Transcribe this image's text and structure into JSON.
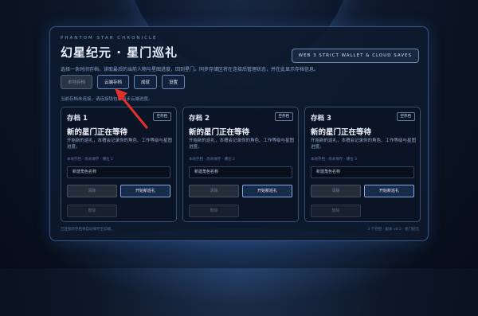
{
  "header": {
    "eyebrow": "PHANTOM STAR CHRONICLE",
    "title": "幻星纪元 · 星门巡礼",
    "subtitle": "选择一条时间存档，读取最后的当前人物与星图进度，回到星门。同步存储区将在连接后管理状态，并在此显示存档信息。",
    "network_label": "WEB 3 STRICT WALLET & CLOUD SAVES"
  },
  "tabs": [
    {
      "label": "本地存档",
      "active": true
    },
    {
      "label": "云端存档",
      "active": false
    },
    {
      "label": "成就",
      "active": false
    },
    {
      "label": "设置",
      "active": false
    }
  ],
  "note": "当前存档未连接，请连接钱包后同步云端进度。",
  "slots": [
    {
      "name": "存档 1",
      "badge": "空存档",
      "status": "新的星门正在等待",
      "description": "开始新的巡礼，本槽会记录你的角色、工作等级与星图进度。",
      "hint": "本地存档 · 尚未保存 · 槽位 1",
      "input_placeholder": "新建角色名称",
      "clear_label": "清除",
      "start_label": "开始新巡礼",
      "delete_label": "删除"
    },
    {
      "name": "存档 2",
      "badge": "空存档",
      "status": "新的星门正在等待",
      "description": "开始新的巡礼，本槽会记录你的角色、工作等级与星图进度。",
      "hint": "本地存档 · 尚未保存 · 槽位 2",
      "input_placeholder": "新建角色名称",
      "clear_label": "清除",
      "start_label": "开始新巡礼",
      "delete_label": "删除"
    },
    {
      "name": "存档 3",
      "badge": "空存档",
      "status": "新的星门正在等待",
      "description": "开始新的巡礼，本槽会记录你的角色、工作等级与星图进度。",
      "hint": "本地存档 · 尚未保存 · 槽位 3",
      "input_placeholder": "新建角色名称",
      "clear_label": "清除",
      "start_label": "开始新巡礼",
      "delete_label": "删除"
    }
  ],
  "footer": {
    "left": "已连接的存档将自动保存至云端。",
    "right": "3 个存档 · 版本 v0.2 · 星门纪元"
  },
  "colors": {
    "accent": "#e0312b",
    "panel_border": "#6ea0e6"
  }
}
